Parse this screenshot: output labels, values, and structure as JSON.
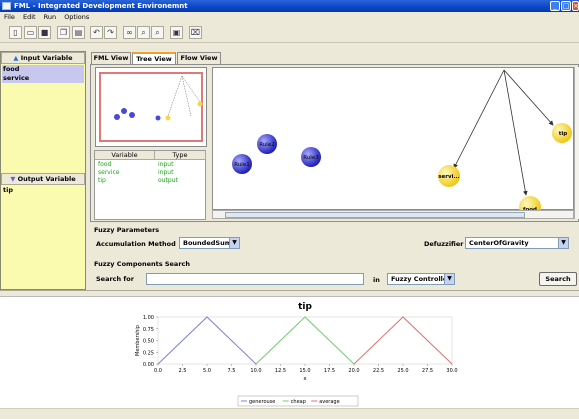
{
  "window": {
    "title": "FML - Integrated Development Environemnt"
  },
  "menu": [
    "File",
    "Edit",
    "Run",
    "Options"
  ],
  "toolbar": {
    "icons": [
      "new-file-icon",
      "open-icon",
      "save-icon",
      "copy-icon",
      "print-icon",
      "undo-icon",
      "redo-icon",
      "binoculars-icon",
      "find-icon",
      "find-next-icon",
      "run-icon",
      "help-icon"
    ]
  },
  "left_panel": {
    "input_header": "Input Variable",
    "input_items": [
      "food",
      "service"
    ],
    "output_header": "Output Variable",
    "output_items": [
      "tip"
    ]
  },
  "tabs": [
    "FML View",
    "Tree View",
    "Flow View"
  ],
  "var_table": {
    "headers": [
      "Variable",
      "Type"
    ],
    "rows": [
      {
        "variable": "food",
        "type": "input"
      },
      {
        "variable": "service",
        "type": "input"
      },
      {
        "variable": "tip",
        "type": "output"
      }
    ]
  },
  "graph": {
    "nodes": [
      "Rule1",
      "Rule2",
      "Rule3",
      "tip",
      "servi...",
      "food"
    ]
  },
  "fuzzy_params": {
    "section_title": "Fuzzy Parameters",
    "accumulation_label": "Accumulation Method",
    "accumulation_value": "BoundedSum",
    "defuzzifier_label": "Defuzzifier",
    "defuzzifier_value": "CenterOfGravity"
  },
  "search": {
    "section_title": "Fuzzy Components Search",
    "label": "Search for",
    "value": "",
    "in_label": "in",
    "scope_value": "Fuzzy Controller",
    "button": "Search"
  },
  "colors": {
    "generous": "#8080d8",
    "cheap": "#70d070",
    "average": "#e07070",
    "node_blue": "#4848d8",
    "node_yellow": "#f8d840"
  },
  "chart_data": {
    "type": "line",
    "title": "tip",
    "xlabel": "x",
    "ylabel": "Membership",
    "xlim": [
      0,
      30
    ],
    "ylim": [
      0,
      1
    ],
    "x_ticks": [
      "0.0",
      "2.5",
      "5.0",
      "7.5",
      "10.0",
      "12.5",
      "15.0",
      "17.5",
      "20.0",
      "22.5",
      "25.0",
      "27.5",
      "30.0"
    ],
    "y_ticks": [
      "0.00",
      "0.25",
      "0.50",
      "0.75",
      "1.00"
    ],
    "series": [
      {
        "name": "generouse",
        "color": "#8080d8",
        "x": [
          0,
          5,
          10
        ],
        "y": [
          0,
          1,
          0
        ]
      },
      {
        "name": "cheap",
        "color": "#70d070",
        "x": [
          10,
          15,
          20
        ],
        "y": [
          0,
          1,
          0
        ]
      },
      {
        "name": "average",
        "color": "#e07070",
        "x": [
          20,
          25,
          30
        ],
        "y": [
          0,
          1,
          0
        ]
      }
    ],
    "legend_position": "bottom"
  }
}
